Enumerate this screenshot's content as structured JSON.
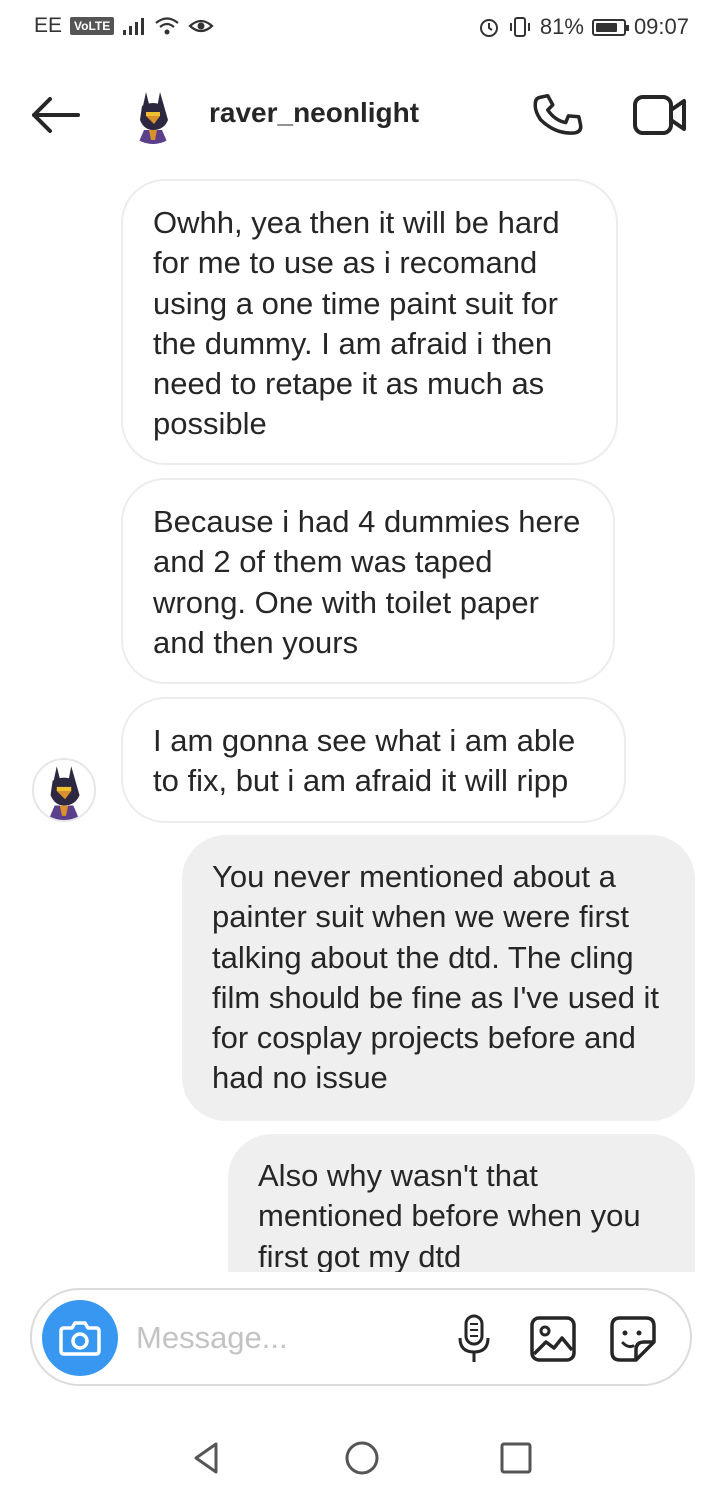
{
  "status_bar": {
    "carrier": "EE",
    "volte": "VoLTE",
    "battery_percent": "81%",
    "battery_level": 0.81,
    "time": "09:07",
    "icons": [
      "signal-icon",
      "wifi-icon",
      "eye-icon",
      "alarm-icon",
      "vibrate-icon",
      "battery-icon"
    ]
  },
  "header": {
    "username": "raver_neonlight",
    "icons": [
      "back-arrow-icon",
      "phone-icon",
      "video-camera-icon"
    ]
  },
  "messages": [
    {
      "direction": "incoming",
      "text": "Owhh, yea then it will be hard for me to use as i recomand using a one time paint suit for the dummy. I am afraid i then need to retape it as much as possible"
    },
    {
      "direction": "incoming",
      "text": "Because i had 4 dummies here and 2 of them was taped wrong. One with toilet paper and then yours"
    },
    {
      "direction": "incoming",
      "text": "I am gonna see what i am able to fix, but i am afraid it will ripp"
    },
    {
      "direction": "outgoing",
      "text": "You never mentioned about a painter suit when we were first talking about the dtd. The cling film should be fine as I've used it for cosplay projects before and had no issue"
    },
    {
      "direction": "outgoing",
      "text": "Also why wasn't that mentioned before when you first got my dtd"
    }
  ],
  "composer": {
    "placeholder": "Message...",
    "icons": [
      "camera-icon",
      "microphone-icon",
      "gallery-icon",
      "sticker-icon"
    ]
  },
  "navigation": {
    "icons": [
      "nav-back-icon",
      "nav-home-icon",
      "nav-recents-icon"
    ]
  },
  "colors": {
    "accent": "#3897f0",
    "outgoing_bubble": "#efefef",
    "incoming_border": "#ececec",
    "text": "#262626",
    "placeholder": "#c3c3c3"
  }
}
